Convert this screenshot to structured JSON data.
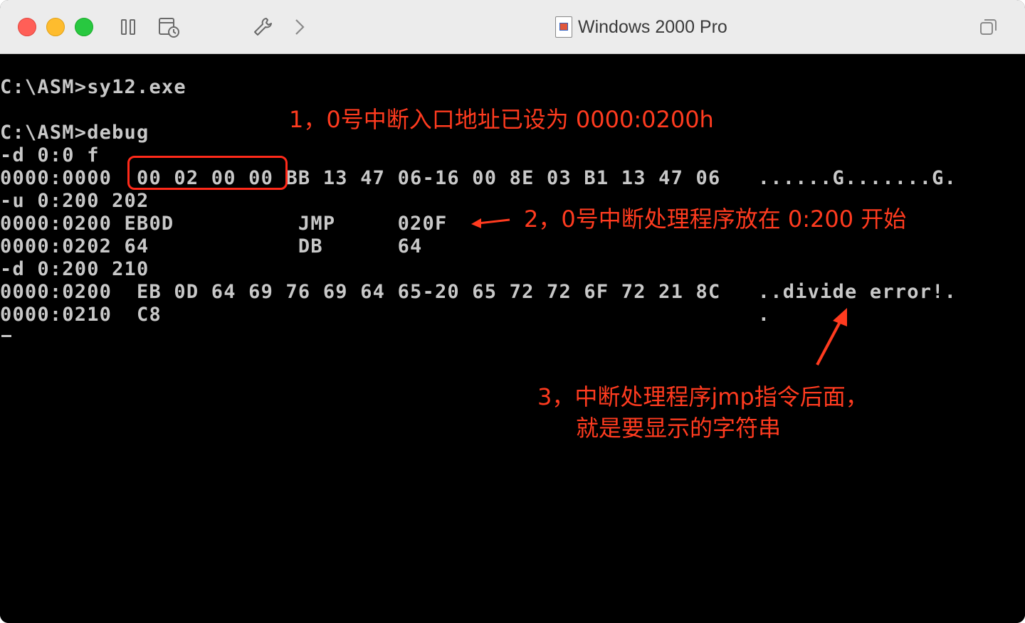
{
  "window": {
    "title": "Windows 2000 Pro"
  },
  "toolbar": {
    "icons": [
      "pause-icon",
      "snapshot-icon",
      "settings-wrench-icon",
      "chevron-right-icon",
      "window-restore-icon"
    ]
  },
  "terminal": {
    "lines": [
      "C:\\ASM>sy12.exe",
      "",
      "C:\\ASM>debug",
      "-d 0:0 f",
      "0000:0000  00 02 00 00 BB 13 47 06-16 00 8E 03 B1 13 47 06   ......G.......G.",
      "-u 0:200 202",
      "0000:0200 EB0D          JMP     020F",
      "0000:0202 64            DB      64",
      "-d 0:200 210",
      "0000:0200  EB 0D 64 69 76 69 64 65-20 65 72 72 6F 72 21 8C   ..divide error!.",
      "0000:0210  C8                                                .",
      ""
    ]
  },
  "annotations": {
    "note1": "1，0号中断入口地址已设为 0000:0200h",
    "note2": "2，0号中断处理程序放在 0:200 开始",
    "note3_line1": "3，中断处理程序jmp指令后面，",
    "note3_line2": "就是要显示的字符串",
    "color": "#ff3b1f"
  },
  "colors": {
    "terminal_bg": "#000000",
    "terminal_fg": "#c8c8c8",
    "titlebar_bg": "#ececec"
  }
}
